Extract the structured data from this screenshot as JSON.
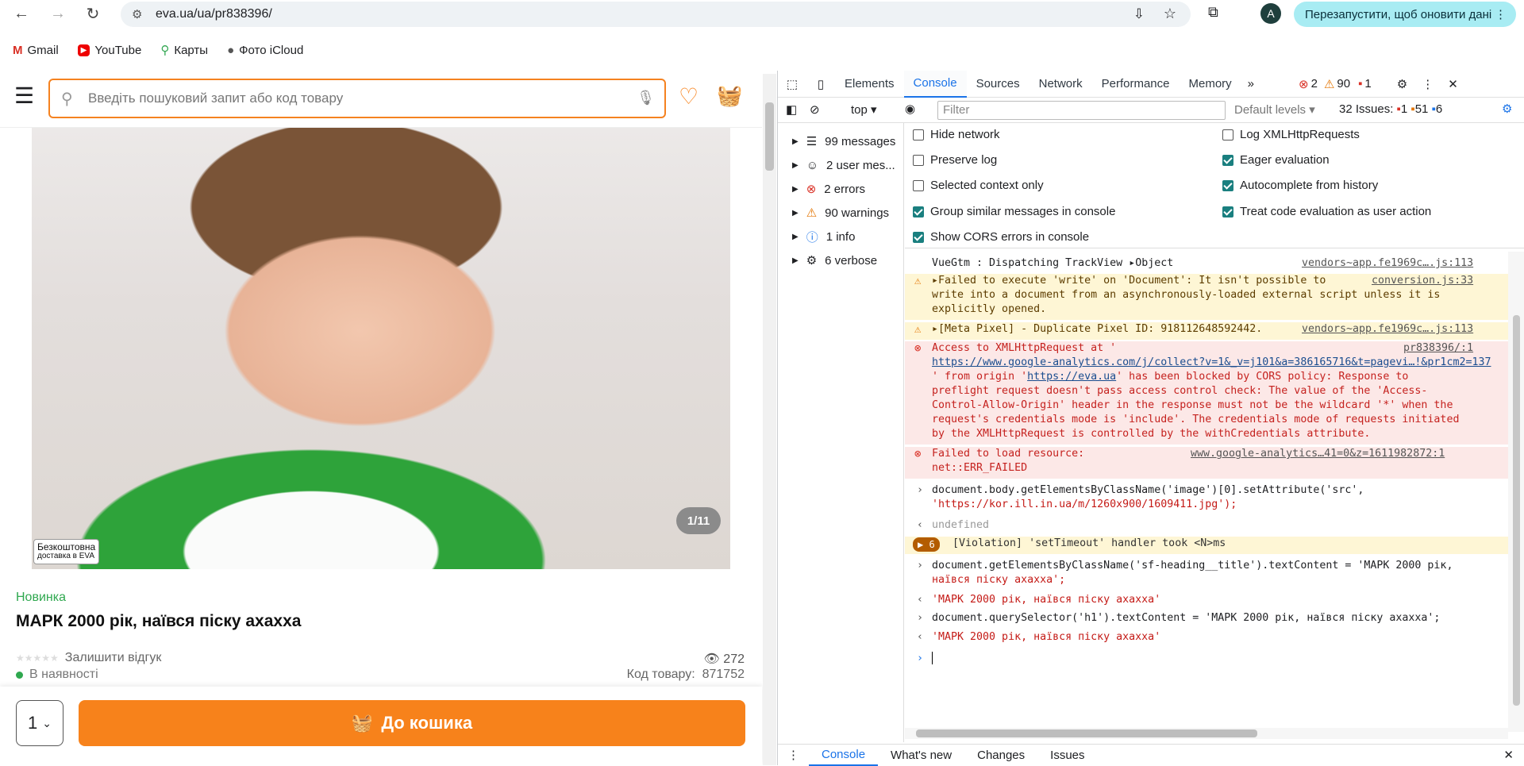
{
  "browser": {
    "url": "eva.ua/ua/pr838396/",
    "profile_initial": "A",
    "relaunch_label": "Перезапустити, щоб оновити дані",
    "bookmarks": [
      {
        "label": "Gmail",
        "icon": "gmail-icon"
      },
      {
        "label": "YouTube",
        "icon": "youtube-icon"
      },
      {
        "label": "Карты",
        "icon": "maps-icon"
      },
      {
        "label": "Фото iCloud",
        "icon": "apple-icon"
      }
    ]
  },
  "page": {
    "search_placeholder": "Введіть пошуковий запит або код товару",
    "image_counter": "1/11",
    "free_delivery_line1": "Безкоштовна",
    "free_delivery_line2": "доставка в EVA",
    "novelty": "Новинка",
    "title": "МАРК 2000 рік, наївся піску ахахха",
    "stars": "★★★★★",
    "review_link": "Залишити відгук",
    "views": "272",
    "stock": "В наявності",
    "code_label": "Код товару:",
    "code_value": "871752",
    "quantity": "1",
    "add_to_cart": "До кошика"
  },
  "devtools": {
    "tabs": [
      "Elements",
      "Console",
      "Sources",
      "Network",
      "Performance",
      "Memory"
    ],
    "active_tab": "Console",
    "error_count": "2",
    "warning_count": "90",
    "issue_count": "1",
    "context": "top",
    "filter_placeholder": "Filter",
    "levels": "Default levels",
    "issues_label": "32 Issues:",
    "issues_err": "1",
    "issues_warn": "51",
    "issues_info": "6",
    "sidebar": [
      {
        "label": "99 messages",
        "icon": "list-icon"
      },
      {
        "label": "2 user mes...",
        "icon": "user-icon"
      },
      {
        "label": "2 errors",
        "icon": "error-icon"
      },
      {
        "label": "90 warnings",
        "icon": "warning-icon"
      },
      {
        "label": "1 info",
        "icon": "info-icon"
      },
      {
        "label": "6 verbose",
        "icon": "bug-icon"
      }
    ],
    "settings": [
      {
        "label": "Hide network",
        "checked": false
      },
      {
        "label": "Log XMLHttpRequests",
        "checked": false
      },
      {
        "label": "Preserve log",
        "checked": false
      },
      {
        "label": "Eager evaluation",
        "checked": true
      },
      {
        "label": "Selected context only",
        "checked": false
      },
      {
        "label": "Autocomplete from history",
        "checked": true
      },
      {
        "label": "Group similar messages in console",
        "checked": true
      },
      {
        "label": "Treat code evaluation as user action",
        "checked": true
      },
      {
        "label": "Show CORS errors in console",
        "checked": true
      }
    ],
    "logs": {
      "l1_text": "VueGtm : Dispatching TrackView",
      "l1_obj": "Object",
      "l1_src": "vendors~app.fe1969c….js:113",
      "w1_a": "Failed to execute 'write' on 'Document': It isn't possible to",
      "w1_b": "write into a document from an asynchronously-loaded external script unless it is",
      "w1_c": "explicitly opened.",
      "w1_src": "conversion.js:33",
      "w2_text": "[Meta Pixel] - Duplicate Pixel ID: 918112648592442.",
      "w2_src": "vendors~app.fe1969c….js:113",
      "e1_a": "Access to XMLHttpRequest at '",
      "e1_src": "pr838396/:1",
      "e1_url": "https://www.google-analytics.com/j/collect?v=1&_v=j101&a=386165716&t=pagevi…!&pr1cm2=137",
      "e1_b1": "' from origin '",
      "e1_b_link": "https://eva.ua",
      "e1_b2": "' has been blocked by CORS policy: Response to",
      "e1_c": "preflight request doesn't pass access control check: The value of the 'Access-",
      "e1_d": "Control-Allow-Origin' header in the response must not be the wildcard '*' when the",
      "e1_e": "request's credentials mode is 'include'. The credentials mode of requests initiated",
      "e1_f": "by the XMLHttpRequest is controlled by the withCredentials attribute.",
      "e2_a": "Failed to load resource:",
      "e2_b": "net::ERR_FAILED",
      "e2_src": "www.google-analytics…41=0&z=1611982872:1",
      "c1_a": "document.body.getElementsByClassName('image')[0].setAttribute('src',",
      "c1_b": "'https://kor.ill.in.ua/m/1260x900/1609411.jpg');",
      "r1": "undefined",
      "v_count": "6",
      "v_text": "[Violation] 'setTimeout' handler took <N>ms",
      "c2_a": "document.getElementsByClassName('sf-heading__title').textContent = 'МАРК 2000 рік,",
      "c2_b": "наївся піску ахахха';",
      "r2": "'МАРК 2000 рік, наївся піску ахахха'",
      "c3": "document.querySelector('h1').textContent = 'МАРК 2000 рік, наївся піску ахахха';",
      "r3": "'МАРК 2000 рік, наївся піску ахахха'"
    },
    "drawer_tabs": [
      "Console",
      "What's new",
      "Changes",
      "Issues"
    ]
  },
  "colors": {
    "accent_orange": "#f7821b",
    "novelty_green": "#2fa84f",
    "devtools_blue": "#1a73e8"
  }
}
